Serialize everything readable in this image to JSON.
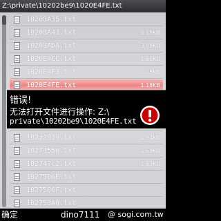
{
  "header": {
    "path": "Z:\\private\\10202be9\\1020E4FE.txt"
  },
  "files": [
    {
      "name": "10208A35.txt",
      "size": ""
    },
    {
      "name": "10208A43.txt",
      "size": "1.15KB"
    },
    {
      "name": "10208ADA.txt",
      "size": "3.08KB"
    },
    {
      "name": "1020E4CC.txt",
      "size": "1.66KB"
    },
    {
      "name": "1020E4F3.txt",
      "size": "1.25KB"
    },
    {
      "name": "1020E4FE.txt",
      "size": "1.18KB"
    },
    {
      "name": "",
      "size": ""
    },
    {
      "name": "",
      "size": ""
    },
    {
      "name": "",
      "size": ""
    },
    {
      "name": "10272039.txt",
      "size": "1.94KB"
    },
    {
      "name": "10274556.txt",
      "size": "1.69KB"
    },
    {
      "name": "102747c2.txt",
      "size": "1.63KB"
    },
    {
      "name": "1027506E.txt",
      "size": ""
    },
    {
      "name": "1027506F.txt",
      "size": ""
    },
    {
      "name": "102750A0.txt",
      "size": ""
    }
  ],
  "selected_index": 5,
  "dialog": {
    "title": "错误!",
    "message_line1": "无法打开文件进行操作: Z:\\",
    "message_line2": "private\\10202be9\\1020E4FE.txt",
    "icon": "exclamation-warning-icon",
    "icon_color": "#cc0000"
  },
  "softkeys": {
    "left": "确定",
    "watermark_user": "dino7111",
    "watermark_site": "@ sogi.com.tw"
  },
  "colors": {
    "header_bg": "#2a2c30",
    "list_bg": "#d2d4d6",
    "selection": "#ef8484"
  }
}
